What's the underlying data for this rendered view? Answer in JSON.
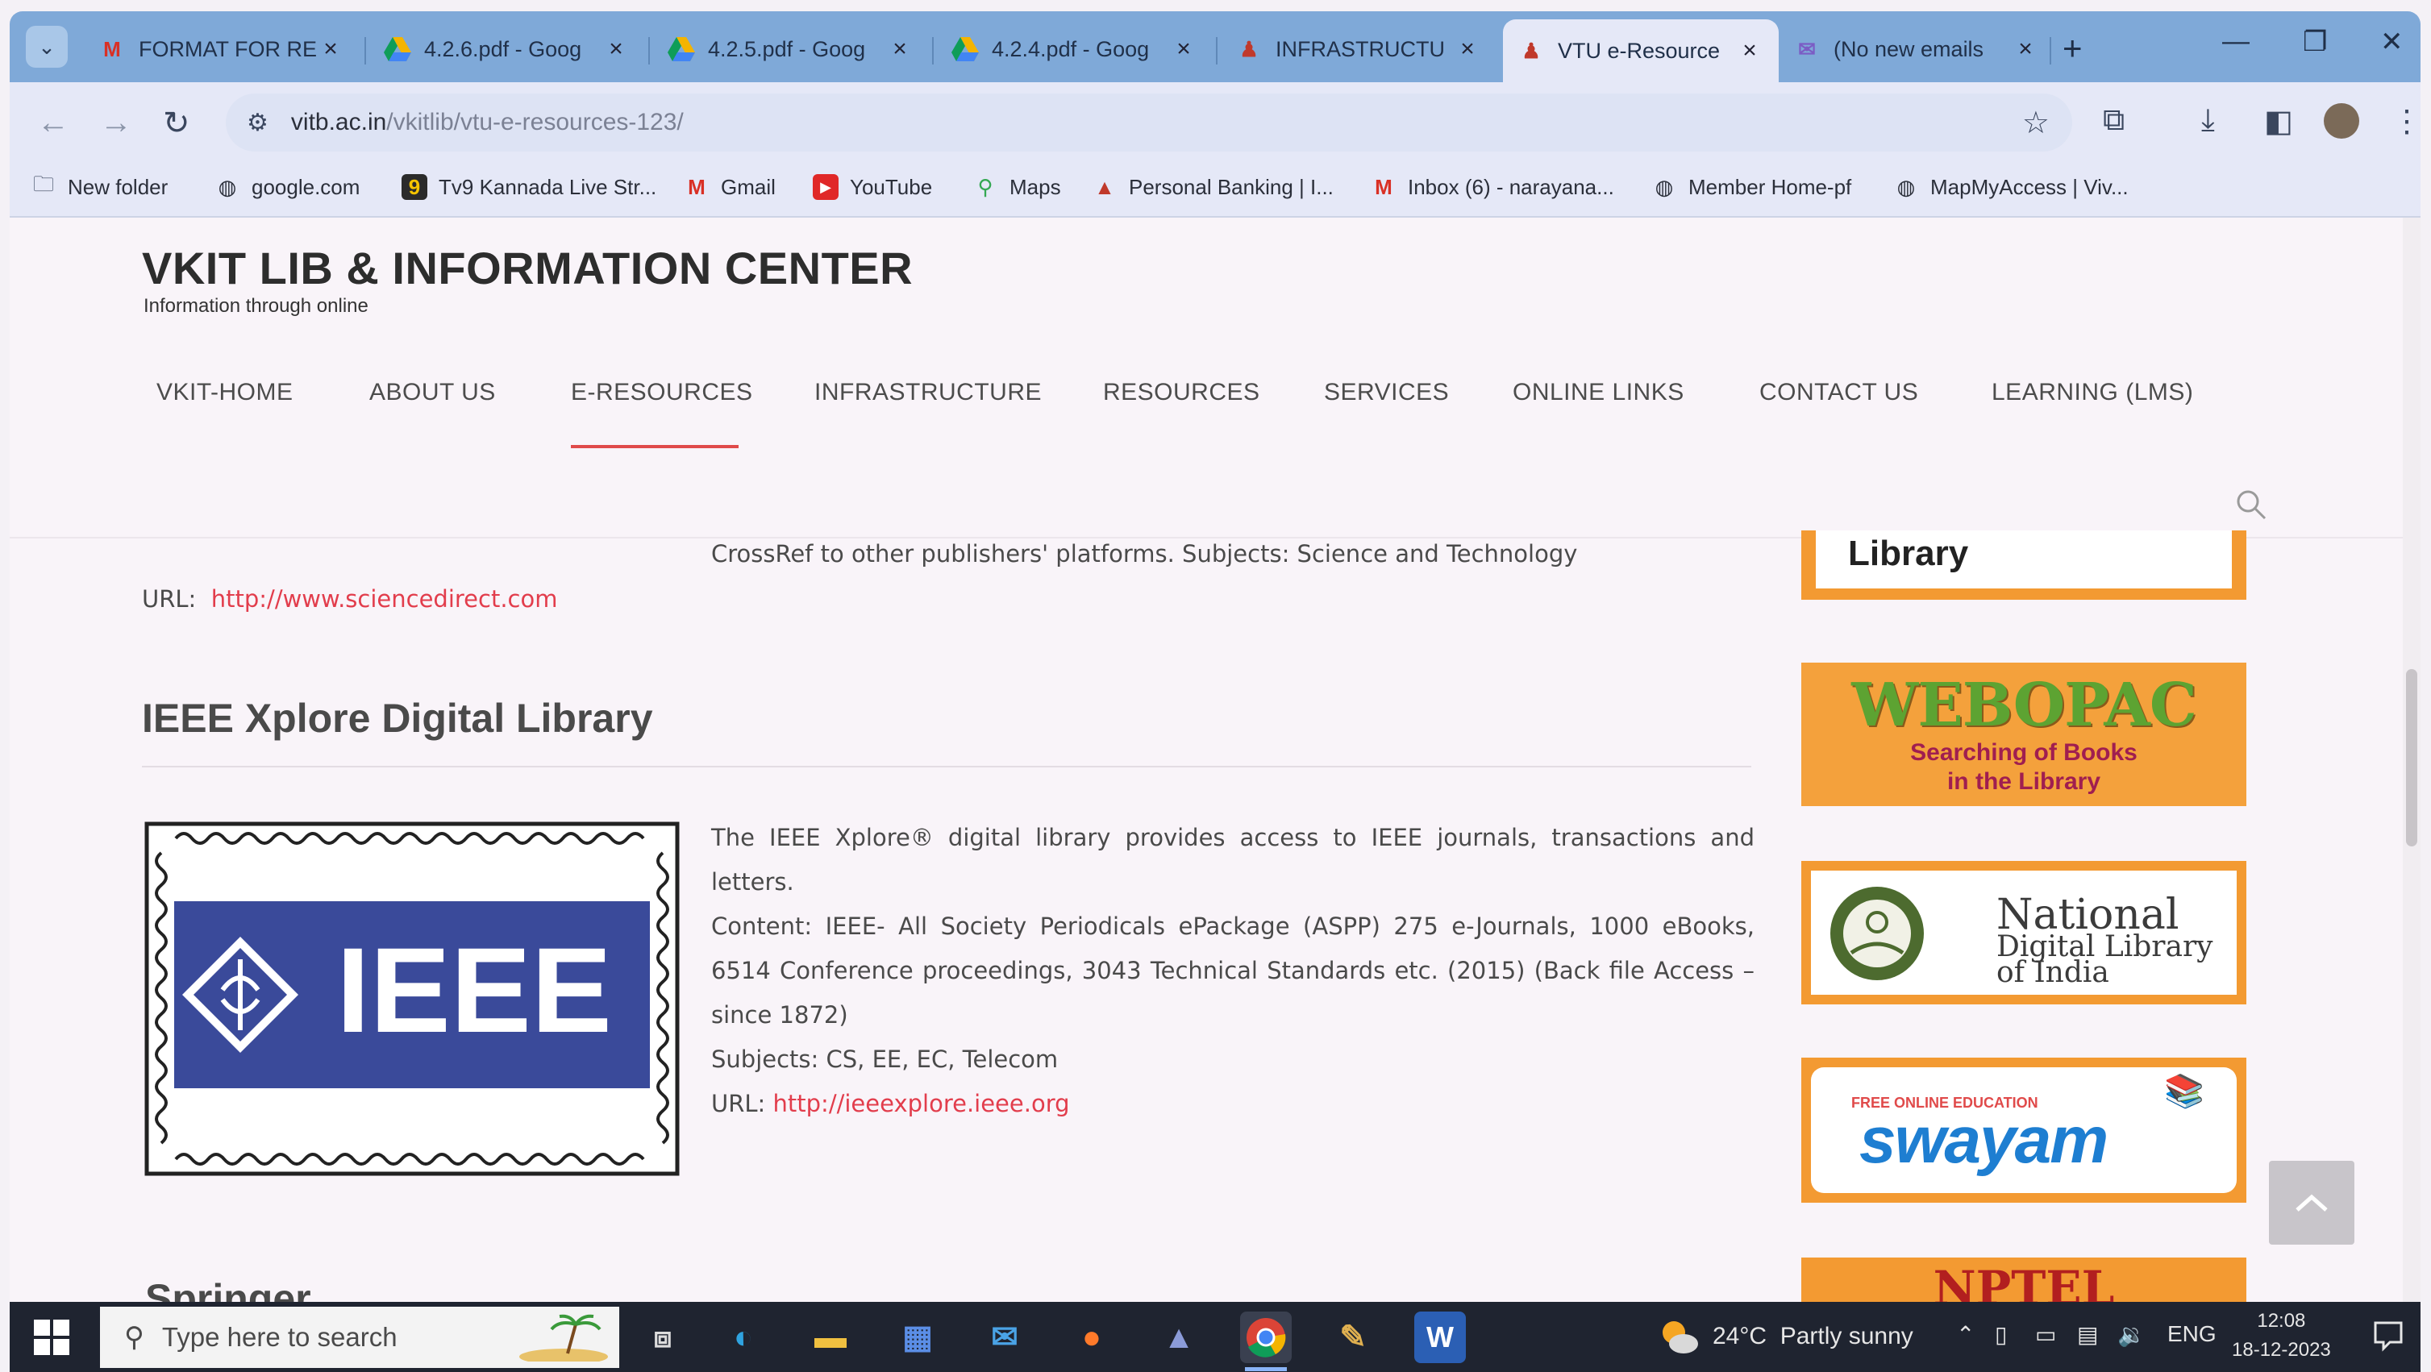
{
  "browser": {
    "tabs": [
      {
        "title": "FORMAT FOR RE",
        "icon": "gmail-icon"
      },
      {
        "title": "4.2.6.pdf - Goog",
        "icon": "google-drive-icon"
      },
      {
        "title": "4.2.5.pdf - Goog",
        "icon": "google-drive-icon"
      },
      {
        "title": "4.2.4.pdf - Goog",
        "icon": "google-drive-icon"
      },
      {
        "title": "INFRASTRUCTU",
        "icon": "site-icon"
      },
      {
        "title": "VTU e-Resource",
        "icon": "site-icon",
        "active": true
      },
      {
        "title": "(No new emails",
        "icon": "mail-icon"
      }
    ],
    "tab_close_glyph": "×",
    "new_tab_glyph": "+",
    "address": {
      "host": "vitb.ac.in",
      "path": "/vkitlib/vtu-e-resources-123/"
    },
    "bookmarks": [
      {
        "label": "New folder",
        "icon": "folder-icon"
      },
      {
        "label": "google.com",
        "icon": "globe-icon"
      },
      {
        "label": "Tv9 Kannada Live Str...",
        "icon": "tv9-icon"
      },
      {
        "label": "Gmail",
        "icon": "gmail-icon"
      },
      {
        "label": "YouTube",
        "icon": "youtube-icon"
      },
      {
        "label": "Maps",
        "icon": "maps-icon"
      },
      {
        "label": "Personal Banking | I...",
        "icon": "bank-icon"
      },
      {
        "label": "Inbox (6) - narayana...",
        "icon": "gmail-icon"
      },
      {
        "label": "Member Home-pf",
        "icon": "globe-icon"
      },
      {
        "label": "MapMyAccess | Viv...",
        "icon": "globe-icon"
      }
    ]
  },
  "site": {
    "title": "VKIT LIB & INFORMATION CENTER",
    "tagline": "Information through online",
    "menu": [
      {
        "label": "VKIT-HOME"
      },
      {
        "label": "ABOUT US"
      },
      {
        "label": "E-RESOURCES",
        "active": true
      },
      {
        "label": "INFRASTRUCTURE"
      },
      {
        "label": "RESOURCES"
      },
      {
        "label": "SERVICES"
      },
      {
        "label": "ONLINE LINKS"
      },
      {
        "label": "CONTACT US"
      },
      {
        "label": "LEARNING (LMS)"
      }
    ],
    "accent_color": "#e04a4a"
  },
  "content": {
    "crossref_line": "CrossRef to other publishers' platforms. Subjects: Science and Technology",
    "sd_url_label": "URL:",
    "sd_url": "http://www.sciencedirect.com",
    "ieee_heading": "IEEE Xplore Digital Library",
    "ieee_logo_text": "IEEE",
    "ieee_p1": "The IEEE Xplore® digital library provides access to IEEE journals, transactions and letters.",
    "ieee_p2": "Content: IEEE- All Society Periodicals ePackage (ASPP) 275 e-Journals, 1000 eBooks, 6514 Conference proceedings, 3043 Technical Standards etc. (2015) (Back file Access – since 1872)",
    "ieee_p3": "Subjects: CS, EE, EC, Telecom",
    "ieee_url_label": "URL:",
    "ieee_url": "http://ieeexplore.ieee.org",
    "next_heading": "Springer"
  },
  "sidebar": {
    "library_label": "Library",
    "webopac_title": "WEBOPAC",
    "webopac_sub1": "Searching of Books",
    "webopac_sub2": "in the Library",
    "ndl_line1": "National",
    "ndl_line2": "Digital Library",
    "ndl_line3": "of India",
    "swayam_top": "FREE ONLINE EDUCATION",
    "swayam_word": "swayam",
    "nptel_word": "NPTEL",
    "banner_color": "#f39a32"
  },
  "taskbar": {
    "search_placeholder": "Type here to search",
    "weather_temp": "24°C",
    "weather_text": "Partly sunny",
    "lang": "ENG",
    "time": "12:08",
    "date": "18-12-2023"
  }
}
